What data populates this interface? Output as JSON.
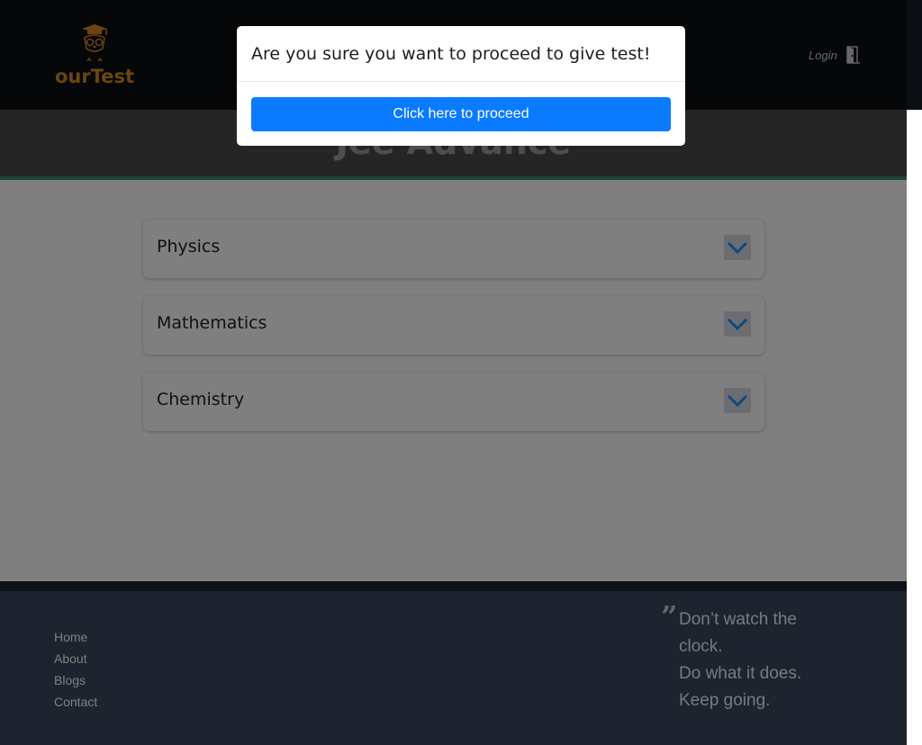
{
  "navbar": {
    "brand": "ourTest",
    "login_label": "Login",
    "icons": {
      "logo": "owl-graduation-cap-logo",
      "login": "door-exit-icon"
    }
  },
  "page_title": "Jee Advance",
  "subjects": [
    {
      "label": "Physics"
    },
    {
      "label": "Mathematics"
    },
    {
      "label": "Chemistry"
    }
  ],
  "footer": {
    "links": [
      "Home",
      "About",
      "Blogs",
      "Contact"
    ],
    "quote_lines": [
      "Don’t watch the",
      "clock.",
      "Do what it does.",
      "Keep going."
    ]
  },
  "modal": {
    "title": "Are you sure you want to proceed to give test!",
    "proceed_label": "Click here to proceed"
  },
  "colors": {
    "navbar_bg": "#0b0e13",
    "brand": "#d98b1c",
    "primary_button": "#0a7bff",
    "footer_bg": "#3a475f",
    "accent_line": "#3d8a6a"
  }
}
